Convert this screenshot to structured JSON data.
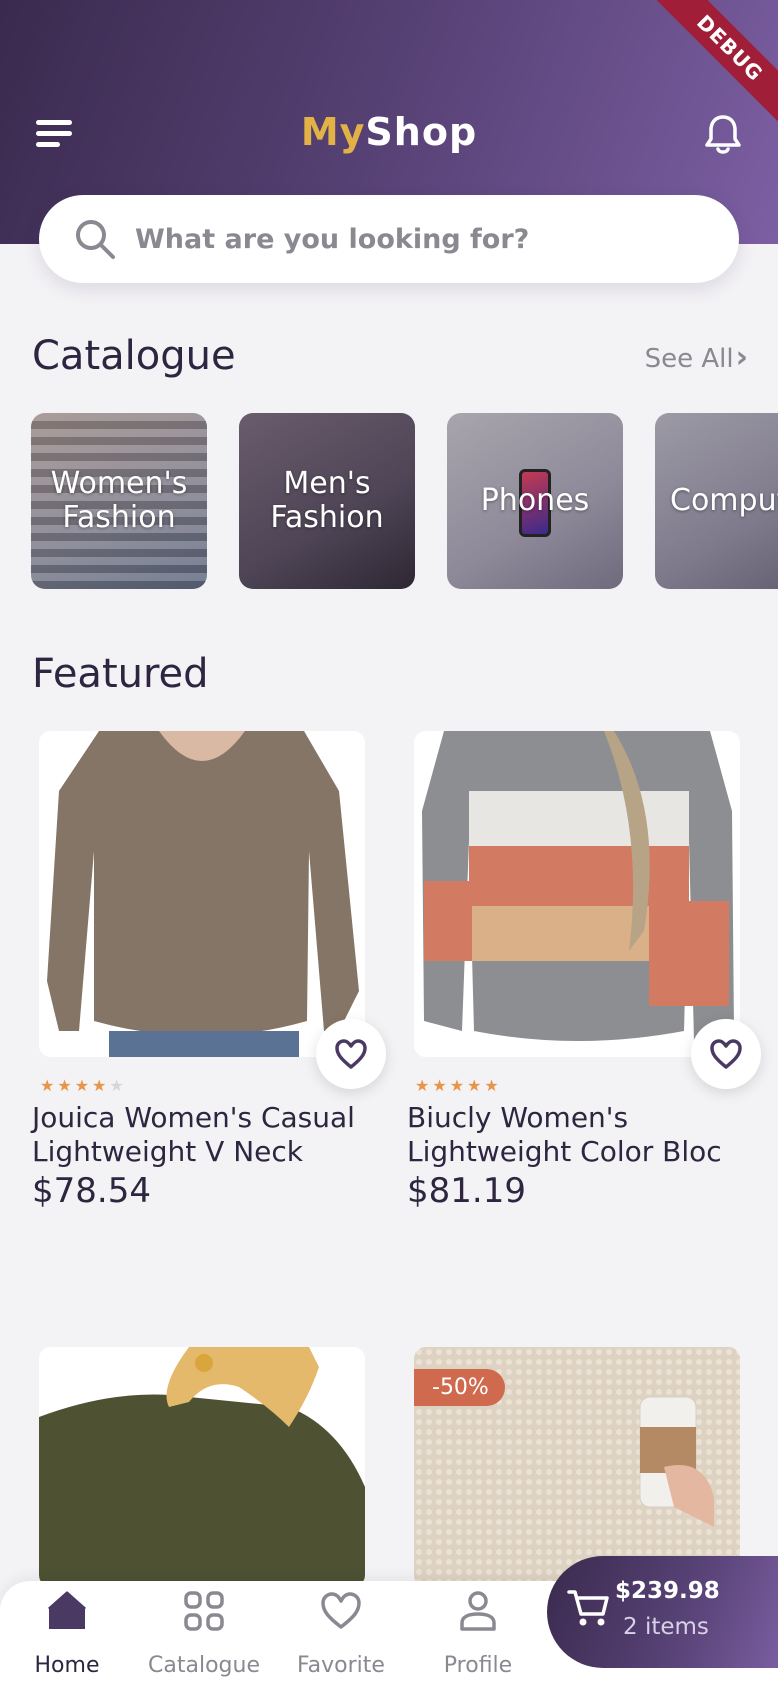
{
  "header": {
    "brand_part1": "My",
    "brand_part2": "Shop",
    "debug_label": "DEBUG"
  },
  "search": {
    "placeholder": "What are you looking for?"
  },
  "catalogue": {
    "title": "Catalogue",
    "see_all": "See All",
    "items": [
      {
        "label": "Women's\nFashion"
      },
      {
        "label": "Men's\nFashion"
      },
      {
        "label": "Phones"
      },
      {
        "label": "Computers"
      }
    ]
  },
  "featured": {
    "title": "Featured",
    "products": [
      {
        "name": "Jouica Women's Casual Lightweight V Neck",
        "price": "$78.54",
        "rating": 4
      },
      {
        "name": "Biucly Women's Lightweight Color Bloc",
        "price": "$81.19",
        "rating": 5
      },
      {
        "name": "",
        "price": "",
        "rating": 0
      },
      {
        "name": "",
        "price": "",
        "rating": 0,
        "badge": "-50%"
      }
    ]
  },
  "nav": {
    "items": [
      {
        "label": "Home",
        "icon": "home-icon"
      },
      {
        "label": "Catalogue",
        "icon": "grid-icon"
      },
      {
        "label": "Favorite",
        "icon": "heart-icon"
      },
      {
        "label": "Profile",
        "icon": "person-icon"
      }
    ]
  },
  "cart": {
    "total": "$239.98",
    "items": "2 items"
  },
  "colors": {
    "primary": "#4a3a63",
    "accent": "#e2b247",
    "star": "#e8954a",
    "badge": "#d06a4e"
  }
}
